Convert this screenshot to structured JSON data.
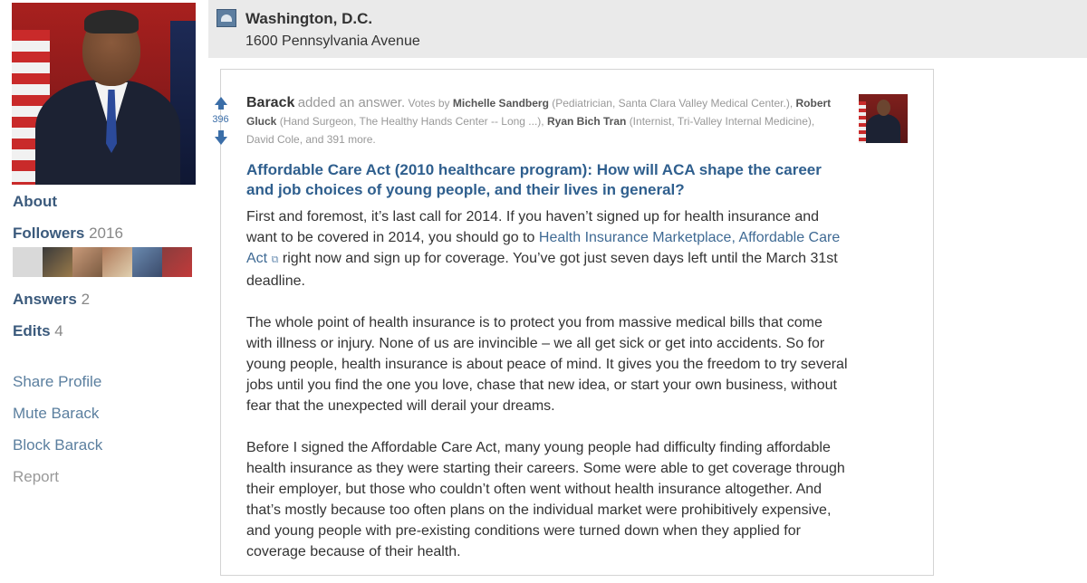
{
  "sidebar": {
    "about": "About",
    "followers_label": "Followers",
    "followers_count": "2016",
    "follower_thumbs": [
      "#c4c4c4",
      "#7d6a4f",
      "#c99a7a",
      "#b07a5a",
      "#6a8ab0",
      "#8a3d3d"
    ],
    "answers_label": "Answers",
    "answers_count": "2",
    "edits_label": "Edits",
    "edits_count": "4",
    "share_profile": "Share Profile",
    "mute": "Mute Barack",
    "block": "Block Barack",
    "report": "Report"
  },
  "location": {
    "city": "Washington, D.C.",
    "address": "1600 Pennsylvania Avenue"
  },
  "answer": {
    "vote_count": "396",
    "author": "Barack",
    "added_text": "added an answer.",
    "votes_by": "Votes by",
    "voters": [
      {
        "name": "Michelle Sandberg",
        "desc": "(Pediatrician, Santa Clara Valley Medical Center.),"
      },
      {
        "name": "Robert Gluck",
        "desc": "(Hand Surgeon, The Healthy Hands Center -- Long ...),"
      },
      {
        "name": "Ryan Bich Tran",
        "desc": "(Internist, Tri-Valley Internal Medicine),"
      }
    ],
    "votes_tail": "David Cole, and 391 more.",
    "question": "Affordable Care Act (2010 healthcare program): How will ACA shape the career and job choices of young people, and their lives in general?",
    "p1_a": "First and foremost, it’s last call for 2014.  If you haven’t signed up for health insurance and want to be covered in 2014, you should go to ",
    "p1_link": "Health Insurance Marketplace, Affordable Care Act",
    "p1_b": " right now and sign up for coverage. You’ve got just seven days left until the March 31st deadline.",
    "p2": "The whole point of health insurance is to protect you from massive medical bills that come with illness or injury.  None of us are invincible – we all get sick or get into accidents.  So for young people, health insurance is about peace of mind. It gives you the freedom to try several jobs until you find the one you love, chase that new idea, or start your own business, without fear that the unexpected will derail your dreams.",
    "p3": "Before I signed the Affordable Care Act, many young people had difficulty finding affordable health insurance as they were starting their careers. Some were able to get coverage through their employer, but those who couldn’t often went without health insurance altogether. And that’s mostly because too often plans on the individual market were prohibitively expensive, and young people with pre-existing conditions were turned down when they applied for coverage because of their health."
  }
}
